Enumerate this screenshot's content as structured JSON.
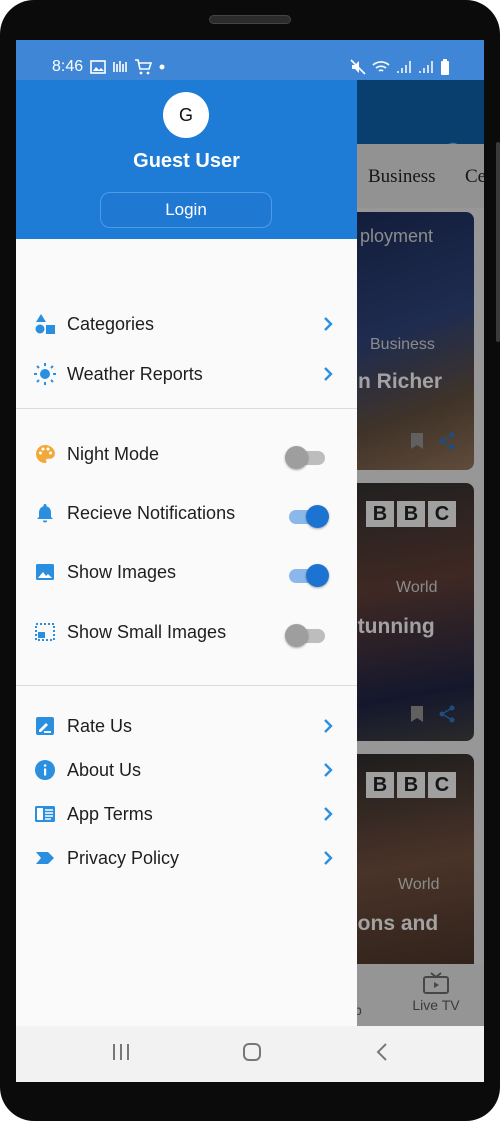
{
  "status_bar": {
    "time": "8:46",
    "left_icons": [
      "gallery-icon",
      "wifi-calling-icon",
      "cart-icon",
      "dot-icon"
    ],
    "right_icons": [
      "mute-icon",
      "wifi-icon",
      "signal-icon",
      "signal-icon",
      "battery-icon"
    ]
  },
  "background_app": {
    "tabs": [
      "Business",
      "Ce"
    ],
    "cards": [
      {
        "top_text": "ployment",
        "category": "Business",
        "headline": "n Richer"
      },
      {
        "top_text": "BBC",
        "category": "World",
        "headline": "stunning"
      },
      {
        "top_text": "BBC",
        "category": "World",
        "headline": "cons and"
      }
    ],
    "bottom_nav": {
      "partial_label": "p",
      "live_tv_label": "Live TV"
    }
  },
  "drawer": {
    "header": {
      "avatar_initial": "G",
      "username": "Guest User",
      "login_label": "Login"
    },
    "section1": [
      {
        "label": "Categories",
        "icon": "shapes-icon"
      },
      {
        "label": "Weather Reports",
        "icon": "sun-icon"
      }
    ],
    "section2": [
      {
        "label": "Night Mode",
        "icon": "palette-icon",
        "enabled": false
      },
      {
        "label": "Recieve Notifications",
        "icon": "bell-icon",
        "enabled": true
      },
      {
        "label": "Show Images",
        "icon": "image-icon",
        "enabled": true
      },
      {
        "label": "Show Small Images",
        "icon": "dotted-image-icon",
        "enabled": false
      }
    ],
    "section3": [
      {
        "label": "Rate Us",
        "icon": "rate-icon"
      },
      {
        "label": "About Us",
        "icon": "info-icon"
      },
      {
        "label": "App Terms",
        "icon": "terms-icon"
      },
      {
        "label": "Privacy Policy",
        "icon": "label-icon"
      }
    ]
  },
  "colors": {
    "header_blue": "#1e7bd6",
    "status_blue": "#3f87d6",
    "icon_blue": "#2b8fe0",
    "toggle_on": "#1c73d1",
    "palette_orange": "#f2a93b"
  }
}
